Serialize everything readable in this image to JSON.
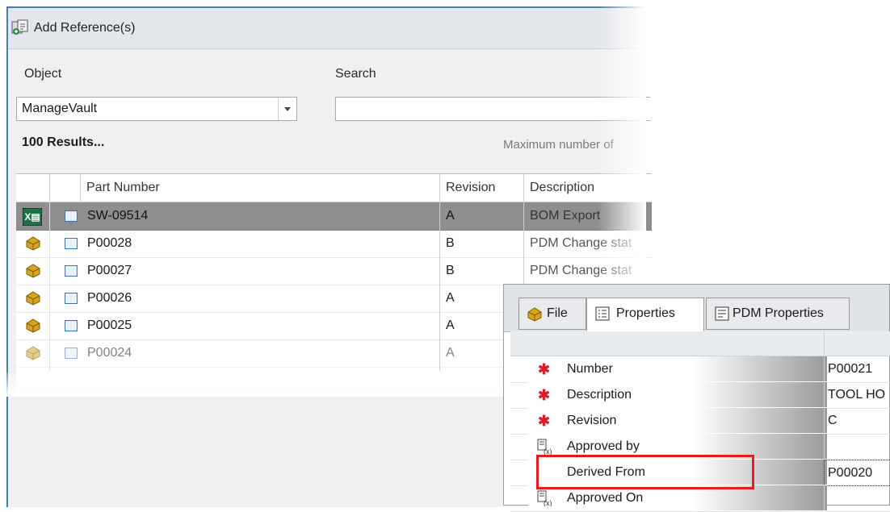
{
  "dialog": {
    "title": "Add Reference(s)",
    "object_label": "Object",
    "search_label": "Search",
    "object_value": "ManageVault",
    "search_value": "",
    "results_text": "100 Results...",
    "max_text": "Maximum number of"
  },
  "grid": {
    "columns": [
      "Part Number",
      "Revision",
      "Description"
    ],
    "rows": [
      {
        "part": "SW-09514",
        "rev": "A",
        "desc": "BOM Export",
        "icon": "excel-icon",
        "selected": true
      },
      {
        "part": "P00028",
        "rev": "B",
        "desc": "PDM Change stat",
        "icon": "part-icon"
      },
      {
        "part": "P00027",
        "rev": "B",
        "desc": "PDM Change stat",
        "icon": "part-icon"
      },
      {
        "part": "P00026",
        "rev": "A",
        "desc": "",
        "icon": "part-icon"
      },
      {
        "part": "P00025",
        "rev": "A",
        "desc": "",
        "icon": "part-icon"
      },
      {
        "part": "P00024",
        "rev": "A",
        "desc": "",
        "icon": "part-icon"
      }
    ]
  },
  "properties_panel": {
    "tabs": [
      "File",
      "Properties",
      "PDM Properties"
    ],
    "active_tab": "Properties",
    "props": [
      {
        "name": "Number",
        "value": "P00021",
        "required": true
      },
      {
        "name": "Description",
        "value": "TOOL HO",
        "required": true
      },
      {
        "name": "Revision",
        "value": "C",
        "required": true
      },
      {
        "name": "Approved by",
        "value": "",
        "required": false
      },
      {
        "name": "Derived From",
        "value": "P00020",
        "required": false
      },
      {
        "name": "Approved On",
        "value": "",
        "required": false
      }
    ]
  },
  "colors": {
    "accent": "#4a78b0",
    "highlight": "#e02020",
    "selected_row": "#8f8f8f"
  }
}
